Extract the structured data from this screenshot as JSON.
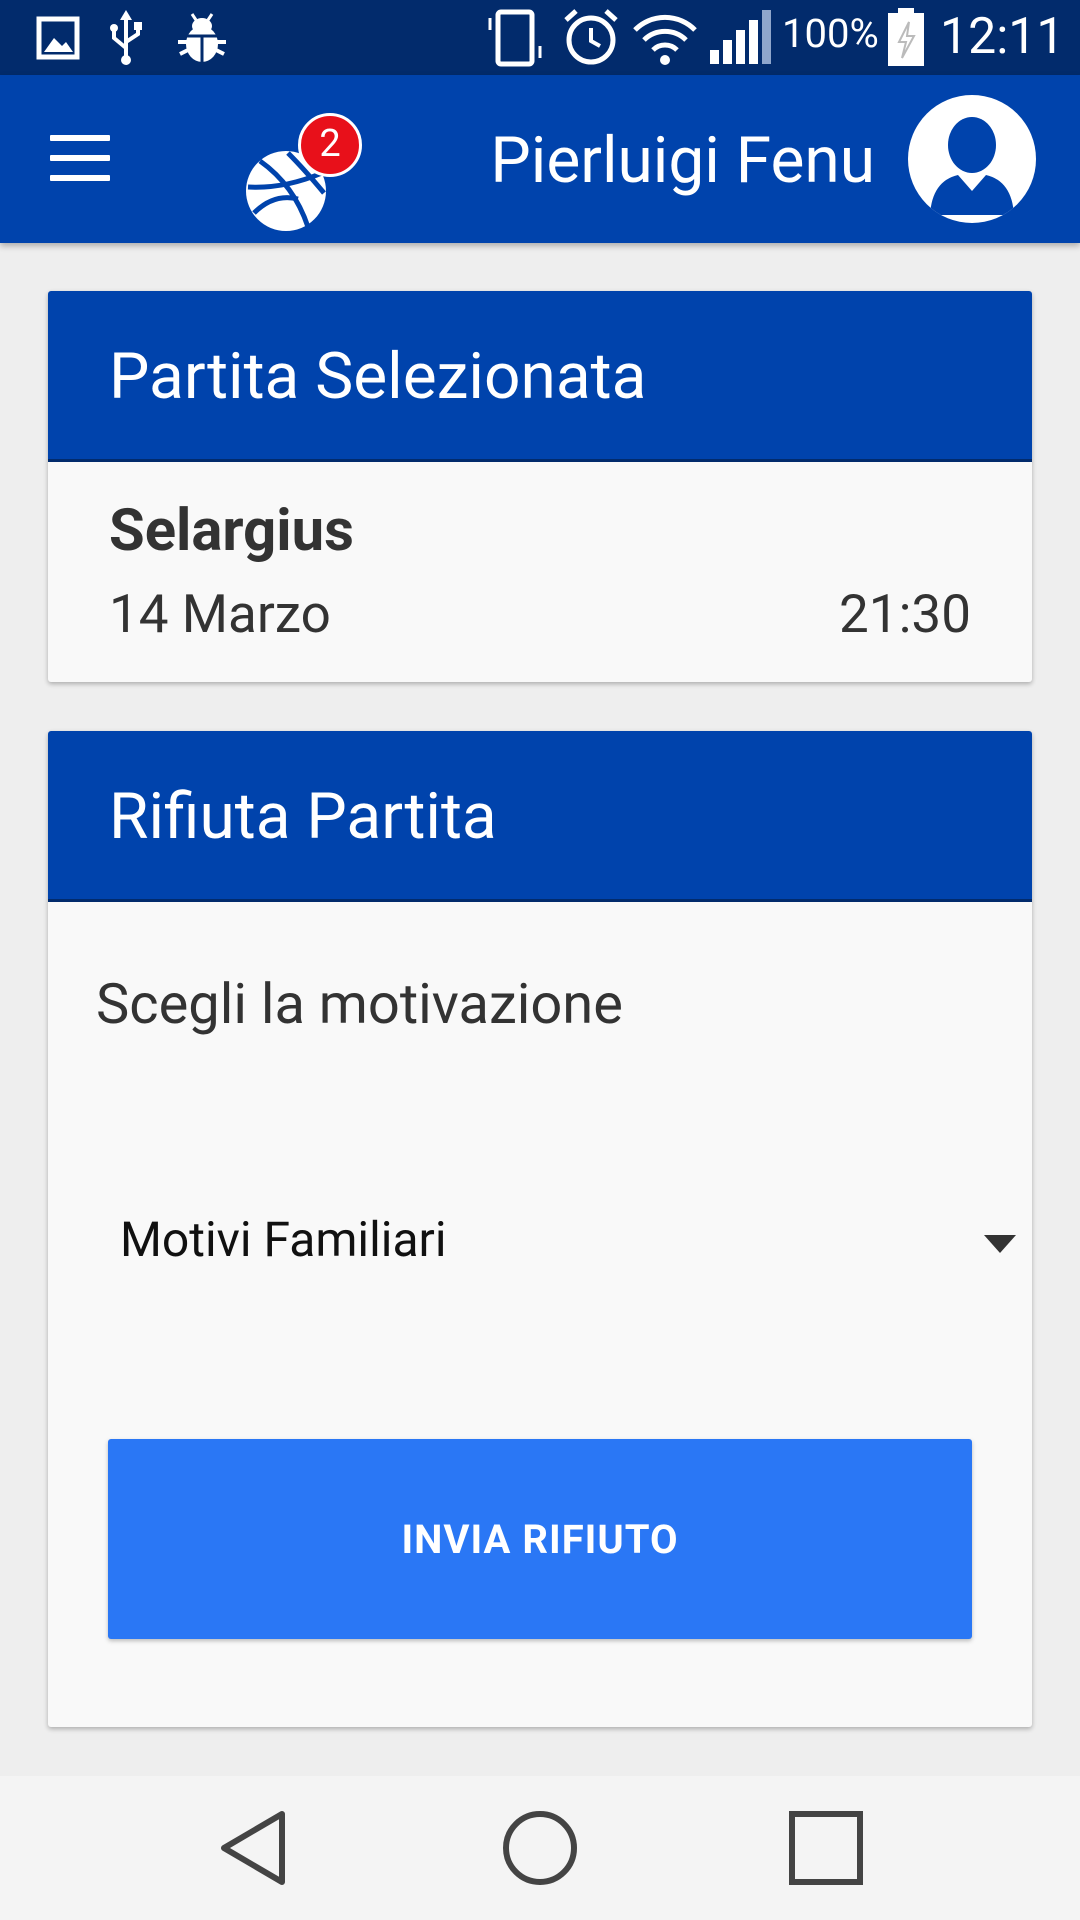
{
  "status_bar": {
    "battery_percent": "100%",
    "time": "12:11",
    "icons": [
      "image-icon",
      "usb-icon",
      "bug-icon",
      "vibrate-icon",
      "alarm-icon",
      "wifi-icon",
      "signal-icon",
      "battery-charging-icon"
    ]
  },
  "app_bar": {
    "notification_count": "2",
    "user_name": "Pierluigi Fenu",
    "icons": [
      "menu-icon",
      "basketball-icon",
      "avatar-icon"
    ]
  },
  "selected_match": {
    "title": "Partita Selezionata",
    "place": "Selargius",
    "date": "14 Marzo",
    "time": "21:30"
  },
  "reject": {
    "title": "Rifiuta Partita",
    "reason_label": "Scegli la motivazione",
    "reason_selected": "Motivi Familiari",
    "submit_label": "INVIA RIFIUTO"
  },
  "nav_bar": {
    "icons": [
      "back-icon",
      "home-icon",
      "recents-icon"
    ]
  },
  "colors": {
    "primary": "#0043ac",
    "status_bar": "#022b6c",
    "button": "#2a77f5",
    "badge": "#e8101a"
  }
}
